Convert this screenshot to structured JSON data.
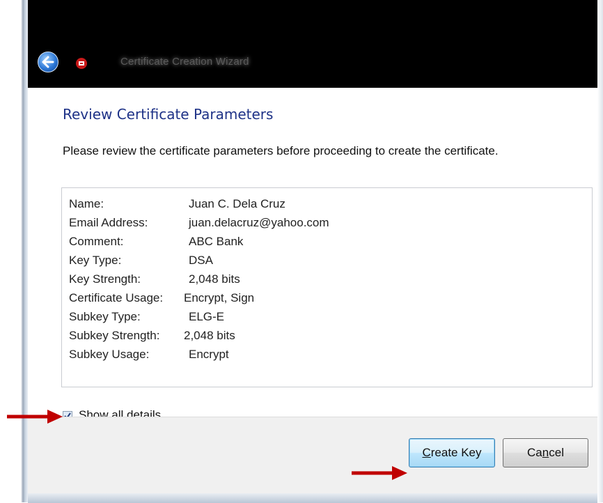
{
  "window": {
    "title": "Certificate Creation Wizard"
  },
  "page": {
    "title": "Review Certificate Parameters",
    "instructions": "Please review the certificate parameters before proceeding to create the certificate."
  },
  "parameters": [
    {
      "label": "Name:",
      "value": "Juan C. Dela Cruz"
    },
    {
      "label": "Email Address:",
      "value": "juan.delacruz@yahoo.com"
    },
    {
      "label": "Comment:",
      "value": "ABC Bank"
    },
    {
      "label": "Key Type:",
      "value": "DSA"
    },
    {
      "label": "Key Strength:",
      "value": "2,048 bits"
    },
    {
      "label": "Certificate Usage:",
      "value": "Encrypt, Sign"
    },
    {
      "label": "Subkey Type:",
      "value": "ELG-E"
    },
    {
      "label": "Subkey Strength:",
      "value": "2,048 bits"
    },
    {
      "label": "Subkey Usage:",
      "value": "Encrypt"
    }
  ],
  "show_details": {
    "label_mnemonic": "S",
    "label_rest": "how all details",
    "checked": true
  },
  "buttons": {
    "create_mnemonic": "C",
    "create_rest": "reate Key",
    "cancel_pre": "Ca",
    "cancel_mnemonic": "n",
    "cancel_post": "cel"
  },
  "icons": {
    "back": "back-arrow-icon",
    "app": "certificate-app-icon",
    "checkbox": "checkmark-icon",
    "annotation": "red-arrow-icon"
  },
  "colors": {
    "titlebar": "#000000",
    "page_title": "#1e3287",
    "annotation_arrow": "#c00000"
  }
}
